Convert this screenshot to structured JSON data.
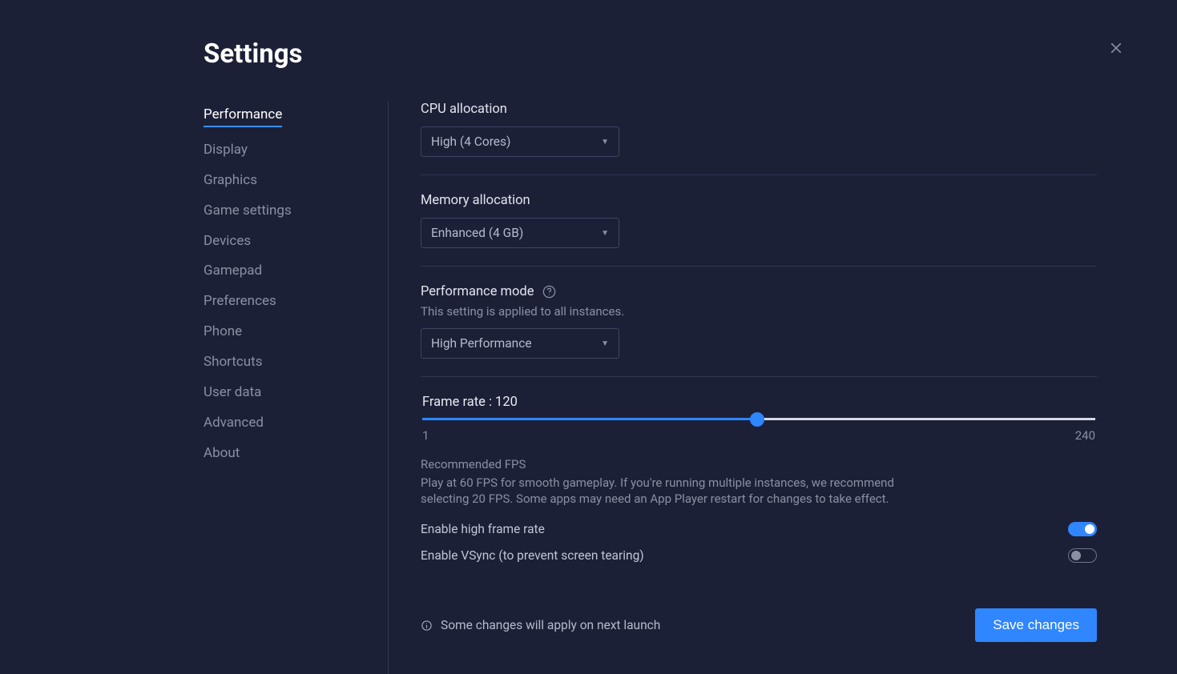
{
  "title": "Settings",
  "sidebar": {
    "items": [
      {
        "label": "Performance",
        "active": true
      },
      {
        "label": "Display",
        "active": false
      },
      {
        "label": "Graphics",
        "active": false
      },
      {
        "label": "Game settings",
        "active": false
      },
      {
        "label": "Devices",
        "active": false
      },
      {
        "label": "Gamepad",
        "active": false
      },
      {
        "label": "Preferences",
        "active": false
      },
      {
        "label": "Phone",
        "active": false
      },
      {
        "label": "Shortcuts",
        "active": false
      },
      {
        "label": "User data",
        "active": false
      },
      {
        "label": "Advanced",
        "active": false
      },
      {
        "label": "About",
        "active": false
      }
    ]
  },
  "sections": {
    "cpu": {
      "label": "CPU allocation",
      "value": "High (4 Cores)"
    },
    "memory": {
      "label": "Memory allocation",
      "value": "Enhanced (4 GB)"
    },
    "perfmode": {
      "label": "Performance mode",
      "note": "This setting is applied to all instances.",
      "value": "High Performance"
    },
    "framerate": {
      "label_prefix": "Frame rate : ",
      "value": "120",
      "min": "1",
      "max": "240",
      "slider_percent": 49.8,
      "recommend_title": "Recommended FPS",
      "recommend_text": "Play at 60 FPS for smooth gameplay. If you're running multiple instances, we recommend selecting 20 FPS. Some apps may need an App Player restart for changes to take effect.",
      "high_fps_label": "Enable high frame rate",
      "high_fps_on": true,
      "vsync_label": "Enable VSync (to prevent screen tearing)",
      "vsync_on": false
    }
  },
  "footer": {
    "note": "Some changes will apply on next launch",
    "save_label": "Save changes"
  }
}
